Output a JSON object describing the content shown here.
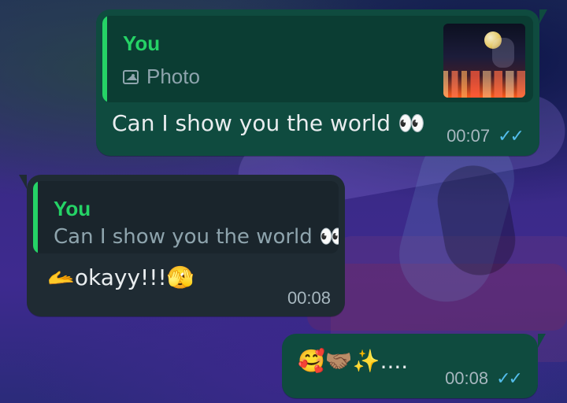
{
  "messages": [
    {
      "direction": "outgoing",
      "quote": {
        "author": "You",
        "subtitle": "Photo",
        "subtitle_icon": "photo-icon",
        "has_thumbnail": true
      },
      "text": "Can I show you the world 👀",
      "time": "00:07",
      "status": "read",
      "status_glyph": "✓✓"
    },
    {
      "direction": "incoming",
      "quote": {
        "author": "You",
        "subtitle": "Can I show you the world 👀"
      },
      "text": "🫴okayy!!!🫣",
      "time": "00:08"
    },
    {
      "direction": "outgoing",
      "text": "🥰🤝🏽✨....",
      "time": "00:08",
      "status": "read",
      "status_glyph": "✓✓"
    }
  ],
  "colors": {
    "outgoing_bubble": "#0f4b3f",
    "incoming_bubble": "#1f2b33",
    "quote_accent": "#25d366",
    "read_ticks": "#53bdeb",
    "meta_text": "#a7b7bf",
    "primary_text": "#e9edef",
    "secondary_text": "#8ea4ad"
  }
}
